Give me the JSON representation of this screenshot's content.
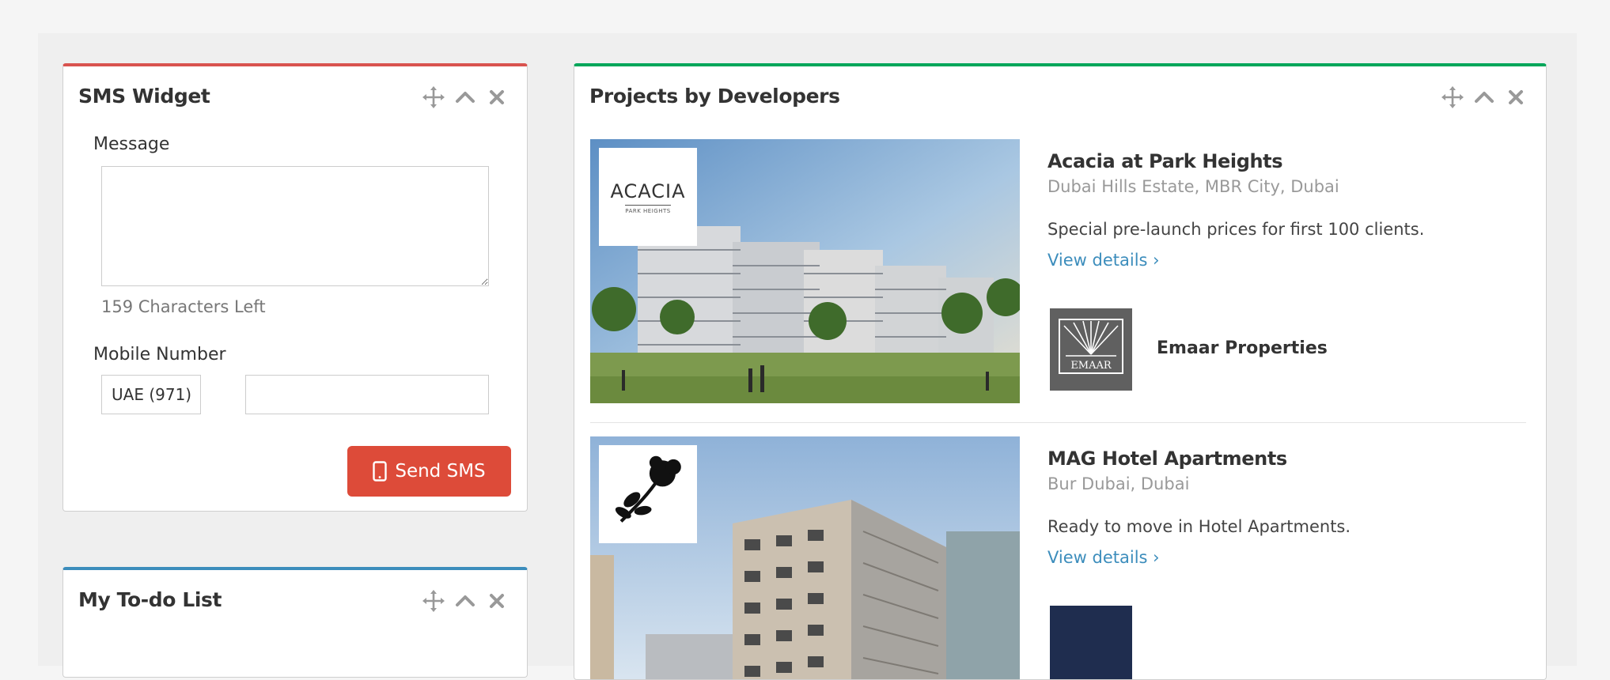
{
  "sms_widget": {
    "title": "SMS Widget",
    "message_label": "Message",
    "message_value": "",
    "chars_left": "159 Characters Left",
    "mobile_label": "Mobile Number",
    "country_code": "UAE (971)",
    "phone_value": "",
    "send_label": "Send SMS",
    "accent": "#d9534f",
    "button_color": "#dd4b39"
  },
  "todo_widget": {
    "title": "My To-do List",
    "accent": "#3c8dbc"
  },
  "projects_widget": {
    "title": "Projects by Developers",
    "accent": "#00a65a",
    "link_color": "#3c8dbc",
    "projects": [
      {
        "name": "Acacia at Park Heights",
        "location": "Dubai Hills Estate, MBR City, Dubai",
        "description": "Special pre-launch prices for first 100 clients.",
        "link": "View details ›",
        "logo_text": "ACACIA",
        "logo_subtext": "PARK HEIGHTS",
        "developer": "Emaar Properties",
        "developer_logo_text": "EMAAR"
      },
      {
        "name": "MAG Hotel Apartments",
        "location": "Bur Dubai, Dubai",
        "description": "Ready to move in Hotel Apartments.",
        "link": "View details ›"
      }
    ]
  },
  "icons": {
    "panel_tools": [
      "move-icon",
      "collapse-chevron-up-icon",
      "close-icon"
    ],
    "send_button": "mobile-phone-icon"
  }
}
